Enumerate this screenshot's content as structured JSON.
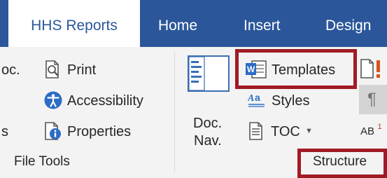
{
  "tabs": [
    {
      "label": "HHS Reports",
      "active": true
    },
    {
      "label": "Home",
      "active": false
    },
    {
      "label": "Insert",
      "active": false
    },
    {
      "label": "Design",
      "active": false
    }
  ],
  "file_tools": {
    "doc_partial": "oc.",
    "print": "Print",
    "accessibility": "Accessibility",
    "partial_s": "s",
    "properties": "Properties",
    "group_label": "File Tools"
  },
  "structure": {
    "doc_nav_line1": "Doc.",
    "doc_nav_line2": "Nav.",
    "templates": "Templates",
    "styles": "Styles",
    "toc": "TOC",
    "group_label": "Structure"
  },
  "extras": {
    "superscript_label": "AB",
    "superscript_mark": "1"
  },
  "colors": {
    "tab_bar": "#2b579a",
    "highlight": "#a11b24",
    "icon_blue": "#2b6cc4"
  }
}
